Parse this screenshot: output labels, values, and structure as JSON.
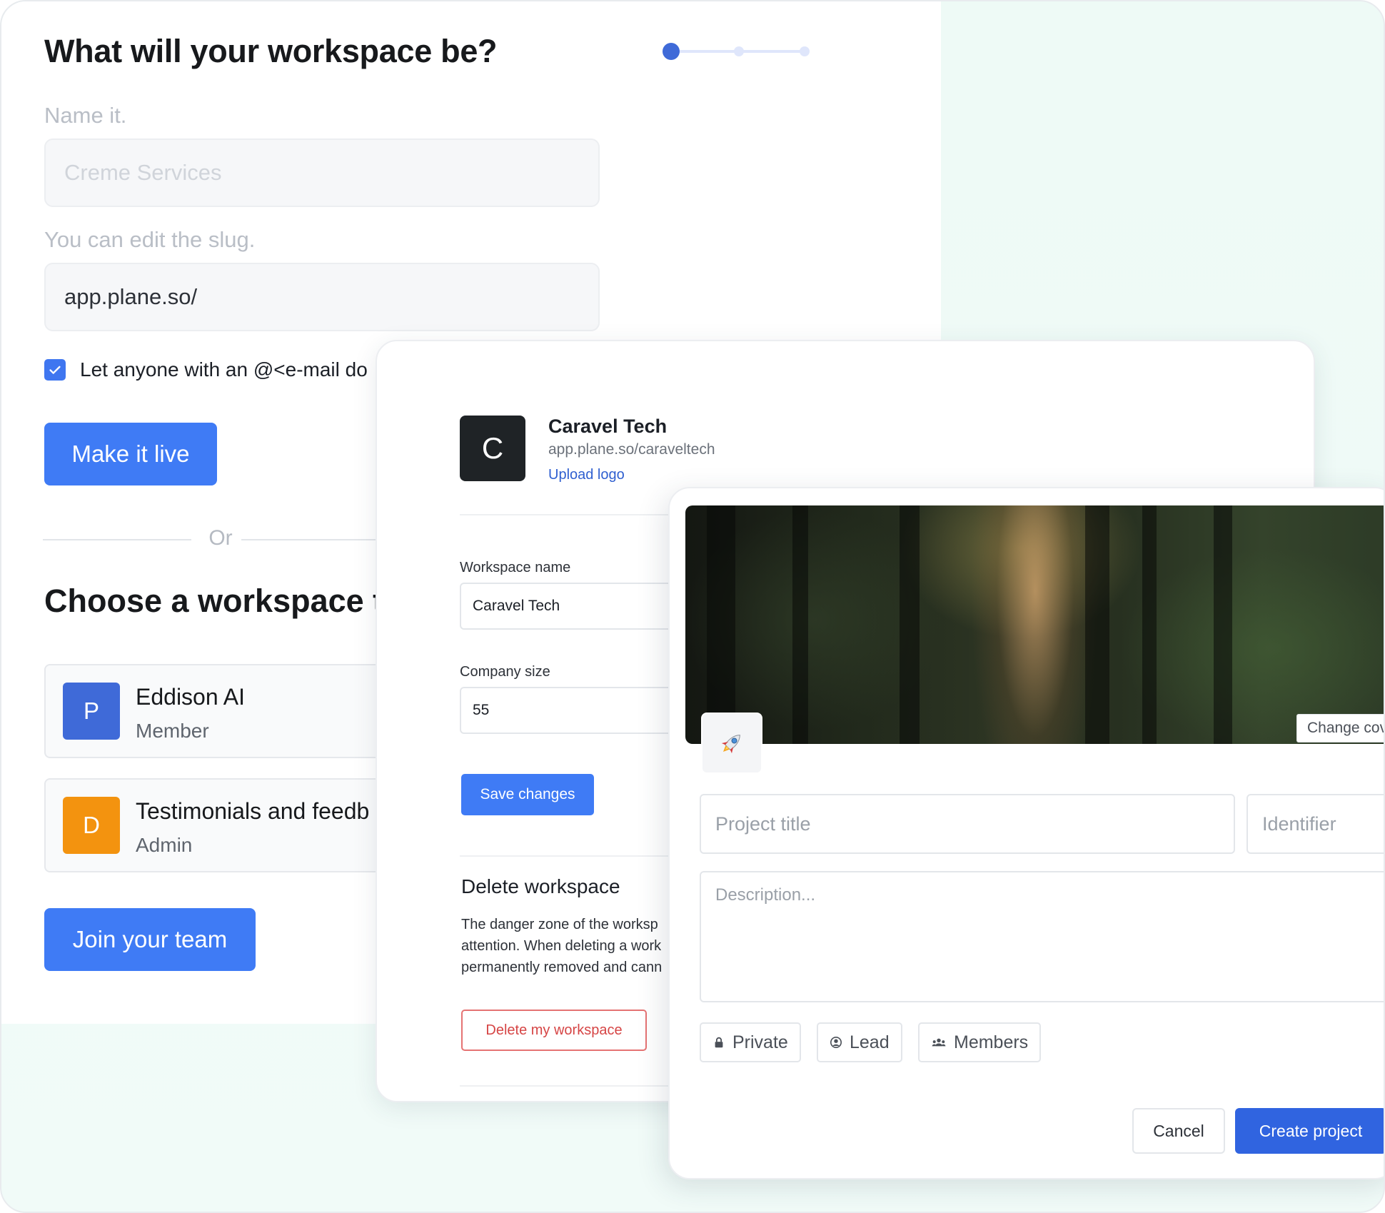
{
  "onboarding": {
    "title": "What will your workspace be?",
    "name_label": "Name it.",
    "name_placeholder": "Creme Services",
    "slug_label": "You can edit the slug.",
    "slug_value": "app.plane.so/",
    "checkbox_label": "Let anyone with an @<e-mail do",
    "checkbox_checked": true,
    "make_live_button": "Make it live",
    "or_text": "Or",
    "choose_title": "Choose a workspace t",
    "workspaces": [
      {
        "initial": "P",
        "name": "Eddison AI",
        "role": "Member",
        "color": "#3f6ad8"
      },
      {
        "initial": "D",
        "name": "Testimonials and feedb",
        "role": "Admin",
        "color": "#f3930f"
      }
    ],
    "join_button": "Join your team",
    "stepper": {
      "total_steps": 3,
      "current_step": 1
    }
  },
  "settings": {
    "logo_initial": "C",
    "workspace_name": "Caravel Tech",
    "workspace_url": "app.plane.so/caraveltech",
    "upload_logo": "Upload logo",
    "name_label": "Workspace name",
    "name_value": "Caravel Tech",
    "size_label": "Company size",
    "size_value": "55",
    "save_button": "Save changes",
    "delete_title": "Delete workspace",
    "delete_body": [
      "The danger zone of the worksp",
      "attention. When deleting a work",
      "permanently removed and cann"
    ],
    "delete_button": "Delete my workspace"
  },
  "project": {
    "change_cover": "Change cove",
    "emoji": "🚀",
    "title_placeholder": "Project title",
    "identifier_placeholder": "Identifier",
    "description_placeholder": "Description...",
    "pills": [
      {
        "label": "Private",
        "icon": "lock-icon"
      },
      {
        "label": "Lead",
        "icon": "user-circle-icon"
      },
      {
        "label": "Members",
        "icon": "members-icon"
      }
    ],
    "cancel_button": "Cancel",
    "create_button": "Create project"
  },
  "colors": {
    "accent": "#3f7bf5",
    "mint_background": "#eefaf6",
    "danger": "#d64545"
  }
}
